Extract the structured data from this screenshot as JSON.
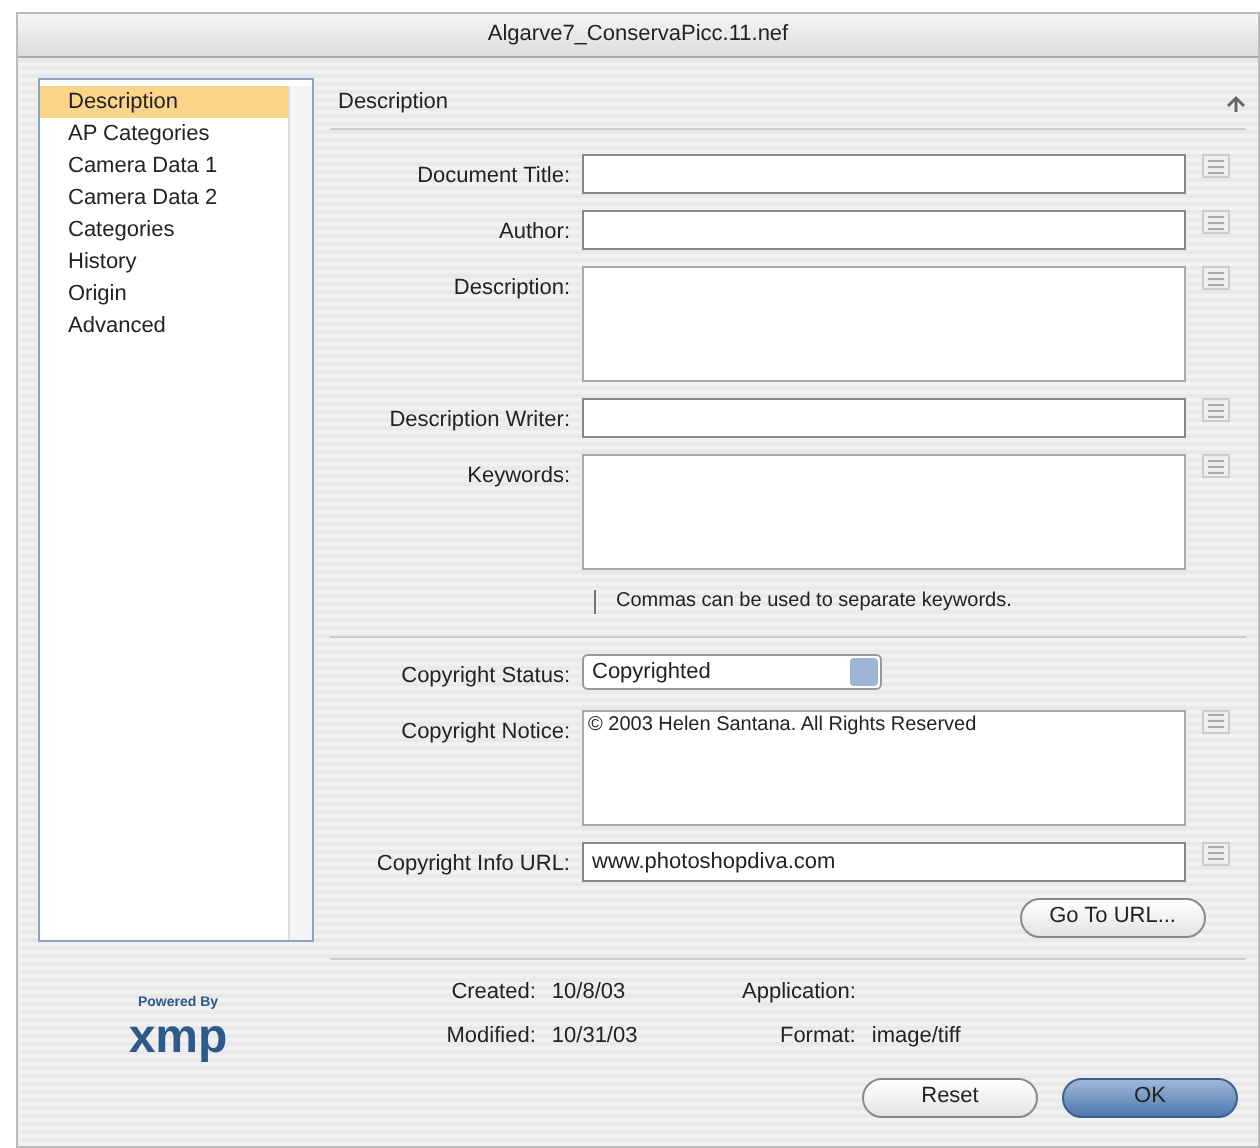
{
  "window": {
    "title": "Algarve7_ConservaPicc.11.nef"
  },
  "sidebar": {
    "items": [
      {
        "label": "Description",
        "selected": true
      },
      {
        "label": "AP Categories",
        "selected": false
      },
      {
        "label": "Camera Data 1",
        "selected": false
      },
      {
        "label": "Camera Data 2",
        "selected": false
      },
      {
        "label": "Categories",
        "selected": false
      },
      {
        "label": "History",
        "selected": false
      },
      {
        "label": "Origin",
        "selected": false
      },
      {
        "label": "Advanced",
        "selected": false
      }
    ]
  },
  "panel": {
    "title": "Description",
    "fields": [
      {
        "kind": "line",
        "label": "Document Title:"
      },
      {
        "kind": "line",
        "label": "Author:"
      },
      {
        "kind": "area",
        "label": "Description:"
      },
      {
        "kind": "line",
        "label": "Description Writer:"
      },
      {
        "kind": "area",
        "label": "Keywords:"
      }
    ],
    "note": "Commas can be used to separate keywords.",
    "copyright_status": {
      "label": "Copyright Status:",
      "value": "Copyrighted"
    },
    "copyright_notice": {
      "label": "Copyright Notice:",
      "value": "© 2003 Helen Santana. All Rights Reserved"
    },
    "copyright_url": {
      "label": "Copyright Info URL:",
      "value": "www.photoshopdiva.com"
    },
    "go_button": "Go To URL..."
  },
  "footer": {
    "logo_caption": "Powered By",
    "logo": "xmp",
    "info": [
      {
        "label": "Created:",
        "value": "10/8/03"
      },
      {
        "label": "Modified:",
        "value": "10/31/03"
      }
    ],
    "app": [
      {
        "label": "Application:"
      },
      {
        "label": "Format:",
        "value": "image/tiff"
      }
    ]
  },
  "buttons": [
    {
      "label": "Reset",
      "kind": "normal"
    },
    {
      "label": "OK",
      "kind": "default"
    }
  ]
}
